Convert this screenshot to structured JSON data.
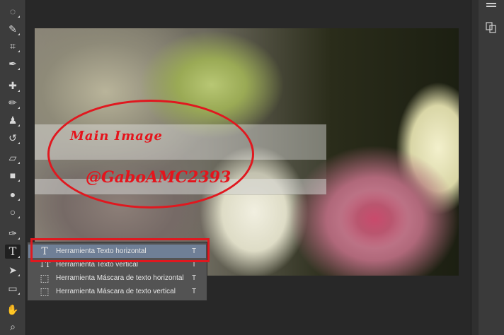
{
  "toolbar": {
    "tools": [
      {
        "name": "lasso-tool-icon",
        "glyph": "◌"
      },
      {
        "name": "quick-selection-tool-icon",
        "glyph": "✎"
      },
      {
        "name": "crop-tool-icon",
        "glyph": "⌗"
      },
      {
        "name": "eyedropper-tool-icon",
        "glyph": "✒"
      },
      {
        "name": "healing-brush-tool-icon",
        "glyph": "✚"
      },
      {
        "name": "brush-tool-icon",
        "glyph": "✏"
      },
      {
        "name": "clone-stamp-tool-icon",
        "glyph": "♟"
      },
      {
        "name": "history-brush-tool-icon",
        "glyph": "↺"
      },
      {
        "name": "eraser-tool-icon",
        "glyph": "▱"
      },
      {
        "name": "gradient-tool-icon",
        "glyph": "■"
      },
      {
        "name": "blur-tool-icon",
        "glyph": "●"
      },
      {
        "name": "dodge-tool-icon",
        "glyph": "○"
      },
      {
        "name": "pen-tool-icon",
        "glyph": "✑"
      },
      {
        "name": "type-tool-icon",
        "glyph": "T"
      },
      {
        "name": "path-selection-tool-icon",
        "glyph": "➤"
      },
      {
        "name": "rectangle-tool-icon",
        "glyph": "▭"
      },
      {
        "name": "hand-tool-icon",
        "glyph": "✋"
      },
      {
        "name": "zoom-tool-icon",
        "glyph": "⌕"
      }
    ]
  },
  "canvas": {
    "watermark_line1": "Main Image",
    "watermark_line2": "@GaboAMC2393"
  },
  "flyout": {
    "items": [
      {
        "label": "Herramienta Texto horizontal",
        "shortcut": "T",
        "icon": "T"
      },
      {
        "label": "Herramienta Texto vertical",
        "shortcut": "T",
        "icon": "↓T"
      },
      {
        "label": "Herramienta Máscara de texto horizontal",
        "shortcut": "T",
        "icon": "⬚"
      },
      {
        "label": "Herramienta Máscara de texto vertical",
        "shortcut": "T",
        "icon": "⬚"
      }
    ]
  },
  "colors": {
    "annotation_red": "#e0181f",
    "selected_item": "#6f7f96",
    "panel_bg": "#3c3c3c"
  }
}
